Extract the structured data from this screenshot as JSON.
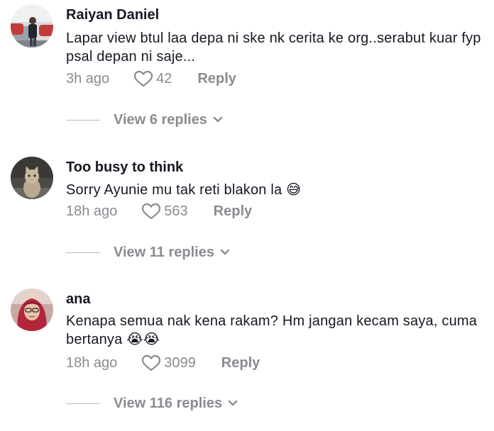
{
  "comments": [
    {
      "username": "Raiyan Daniel",
      "text": "Lapar view btul laa depa ni ske nk cerita ke org..serabut kuar fyp psal depan ni saje...",
      "time": "3h ago",
      "likes": "42",
      "reply_label": "Reply",
      "view_replies": "View 6 replies",
      "avatar_icon": "person-with-car-avatar"
    },
    {
      "username": "Too busy to think",
      "text": "Sorry Ayunie mu tak reti blakon la",
      "emoji": "😅",
      "time": "18h ago",
      "likes": "563",
      "reply_label": "Reply",
      "view_replies": "View 11 replies",
      "avatar_icon": "cat-avatar"
    },
    {
      "username": "ana",
      "text": "Kenapa semua nak kena rakam? Hm jangan kecam saya, cuma bertanya",
      "emoji": "😭😭",
      "time": "18h ago",
      "likes": "3099",
      "reply_label": "Reply",
      "view_replies": "View 116 replies",
      "avatar_icon": "woman-hijab-avatar"
    }
  ],
  "colors": {
    "primary_text": "#161823",
    "secondary_text": "#8a8b91",
    "divider": "#b8b9bd"
  }
}
